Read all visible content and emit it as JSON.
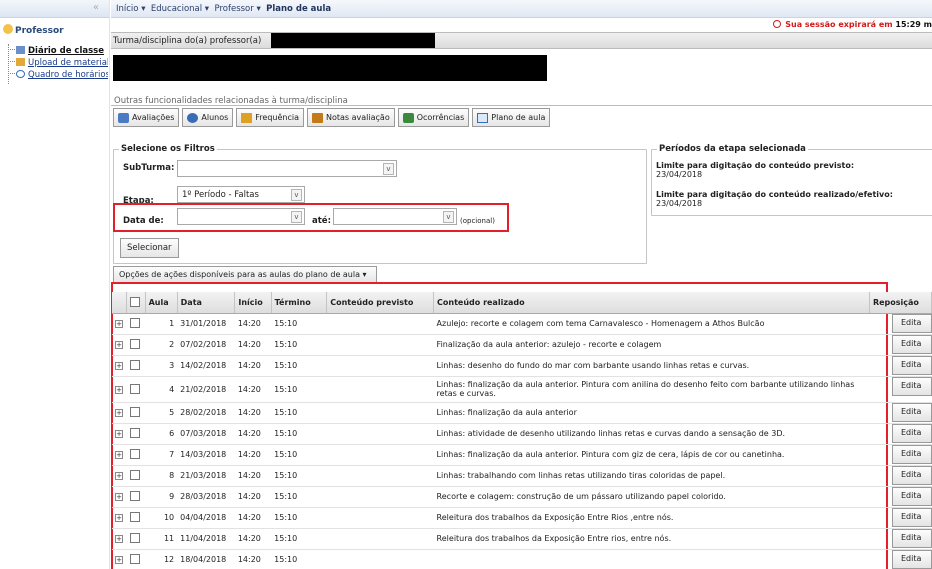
{
  "sidebar": {
    "title": "Professor",
    "items": [
      {
        "label": "Diário de classe"
      },
      {
        "label": "Upload de material"
      },
      {
        "label": "Quadro de horários"
      }
    ]
  },
  "breadcrumb": [
    "Início",
    "Educacional",
    "Professor",
    "Plano de aula"
  ],
  "session": {
    "text": "Sua sessão expirará em",
    "time": "15:29 m"
  },
  "titlebar": {
    "label": "Turma/disciplina do(a) professor(a)"
  },
  "section": {
    "title": "Outras funcionalidades relacionadas à turma/disciplina"
  },
  "toolbar": [
    {
      "label": "Avaliações",
      "icon": "avaliacoes-icon",
      "color": "#4a7bc4"
    },
    {
      "label": "Alunos",
      "icon": "alunos-icon",
      "color": "#3a6bb5"
    },
    {
      "label": "Frequência",
      "icon": "frequencia-icon",
      "color": "#e0a020"
    },
    {
      "label": "Notas avaliação",
      "icon": "notas-icon",
      "color": "#c27a1a"
    },
    {
      "label": "Ocorrências",
      "icon": "ocorrencias-icon",
      "color": "#3b8a3b"
    },
    {
      "label": "Plano de aula",
      "icon": "plano-icon",
      "color": "#2e6fbf"
    }
  ],
  "filters": {
    "legend": "Selecione os Filtros",
    "subturma_label": "SubTurma:",
    "subturma_value": "",
    "etapa_label": "Etapa:",
    "etapa_value": "1º Período - Faltas",
    "data_label": "Data de:",
    "ate_label": "até:",
    "opcional": "(opcional)",
    "selecionar": "Selecionar"
  },
  "periods": {
    "legend": "Períodos da etapa selecionada",
    "previsto_label": "Limite para digitação do conteúdo previsto:",
    "previsto_value": "23/04/2018",
    "realizado_label": "Limite para digitação do conteúdo realizado/efetivo:",
    "realizado_value": "23/04/2018"
  },
  "actions_button": "Opções de ações disponíveis para as aulas do plano de aula ▾",
  "table": {
    "columns": [
      "Aula",
      "Data",
      "Início",
      "Término",
      "Conteúdo previsto",
      "Conteúdo realizado",
      "Reposição"
    ],
    "edit_label": "Edita",
    "rows": [
      {
        "aula": "1",
        "data": "31/01/2018",
        "inicio": "14:20",
        "termino": "15:10",
        "previsto": "",
        "realizado": "Azulejo: recorte e colagem com tema Carnavalesco - Homenagem a Athos Bulcão",
        "reposicao": ""
      },
      {
        "aula": "2",
        "data": "07/02/2018",
        "inicio": "14:20",
        "termino": "15:10",
        "previsto": "",
        "realizado": "Finalização da aula anterior: azulejo - recorte e colagem",
        "reposicao": ""
      },
      {
        "aula": "3",
        "data": "14/02/2018",
        "inicio": "14:20",
        "termino": "15:10",
        "previsto": "",
        "realizado": "Linhas: desenho do fundo do mar com barbante usando linhas retas e curvas.",
        "reposicao": ""
      },
      {
        "aula": "4",
        "data": "21/02/2018",
        "inicio": "14:20",
        "termino": "15:10",
        "previsto": "",
        "realizado": "Linhas: finalização da aula anterior. Pintura com anilina do desenho feito com barbante utilizando linhas retas e curvas.",
        "reposicao": ""
      },
      {
        "aula": "5",
        "data": "28/02/2018",
        "inicio": "14:20",
        "termino": "15:10",
        "previsto": "",
        "realizado": "Linhas: finalização da aula anterior",
        "reposicao": ""
      },
      {
        "aula": "6",
        "data": "07/03/2018",
        "inicio": "14:20",
        "termino": "15:10",
        "previsto": "",
        "realizado": "Linhas: atividade de desenho utilizando linhas retas e curvas dando a sensação de 3D.",
        "reposicao": ""
      },
      {
        "aula": "7",
        "data": "14/03/2018",
        "inicio": "14:20",
        "termino": "15:10",
        "previsto": "",
        "realizado": "Linhas: finalização da aula anterior. Pintura com giz de cera, lápis de cor ou canetinha.",
        "reposicao": ""
      },
      {
        "aula": "8",
        "data": "21/03/2018",
        "inicio": "14:20",
        "termino": "15:10",
        "previsto": "",
        "realizado": "Linhas: trabalhando com linhas retas utilizando tiras coloridas de papel.",
        "reposicao": ""
      },
      {
        "aula": "9",
        "data": "28/03/2018",
        "inicio": "14:20",
        "termino": "15:10",
        "previsto": "",
        "realizado": "Recorte e colagem: construção de um pássaro utilizando papel colorido.",
        "reposicao": ""
      },
      {
        "aula": "10",
        "data": "04/04/2018",
        "inicio": "14:20",
        "termino": "15:10",
        "previsto": "",
        "realizado": "Releitura dos trabalhos da Exposição Entre Rios ,entre nós.",
        "reposicao": ""
      },
      {
        "aula": "11",
        "data": "11/04/2018",
        "inicio": "14:20",
        "termino": "15:10",
        "previsto": "",
        "realizado": "Releitura dos trabalhos da Exposição Entre rios, entre nós.",
        "reposicao": ""
      },
      {
        "aula": "12",
        "data": "18/04/2018",
        "inicio": "14:20",
        "termino": "15:10",
        "previsto": "",
        "realizado": "",
        "reposicao": ""
      }
    ]
  },
  "colors": {
    "highlight": "#e2202a",
    "session": "#d21a1a",
    "link": "#1a3b8a"
  }
}
